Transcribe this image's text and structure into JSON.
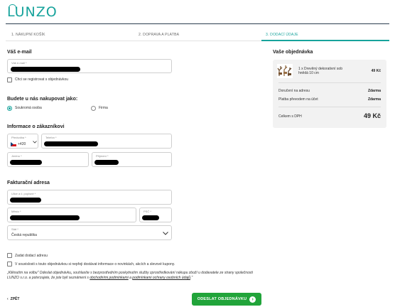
{
  "brand": {
    "logo": "LUNZO",
    "accent": "#17a39c",
    "button_color": "#21a43a"
  },
  "steps": [
    {
      "label": "1. NÁKUPNÍ KOŠÍK"
    },
    {
      "label": "2. DOPRAVA A PLATBA"
    },
    {
      "label": "3. DODACÍ ÚDAJE"
    }
  ],
  "email_section": {
    "title": "Váš e-mail",
    "email_label": "Váš e-mail *",
    "register_label": "Chci se registrovat s objednávkou"
  },
  "buyer_section": {
    "title": "Budete u nás nakupovat jako:",
    "option_private": "Soukromá osoba",
    "option_company": "Firma"
  },
  "customer_section": {
    "title": "Informace o zákazníkovi",
    "prefix_label": "Předvolba *",
    "prefix_value": "+420",
    "phone_label": "Telefon *",
    "first_name_label": "Jméno *",
    "last_name_label": "Příjmení *"
  },
  "billing_section": {
    "title": "Fakturační adresa",
    "street_label": "Ulice a č. popisné *",
    "city_label": "Město *",
    "zip_label": "PSČ *",
    "country_label": "Stát *",
    "country_value": "Česká republika"
  },
  "options": {
    "delivery_address": "Zadat dodací adresu",
    "newsletter": "V souvislosti s touto objednávkou si nepřeji dostávat informace o novinkách, akcích a slevové kupony."
  },
  "legal": {
    "text_1": "„Kliknutím na volbu\" Odeslat objednávku„ souhlasíte s bezprostředním poskytnutím služby zprostředkování nákupu zboží u dodavatele ze strany společnosti LUNZO s.r.o. a potvrzujete, že jste byli seznámeni s ",
    "link_1": "obchodními podmínkami",
    "text_2": " a ",
    "link_2": "podmínkami ochrany osobních údajů",
    "text_3": ".\""
  },
  "order": {
    "title": "Vaše objednávka",
    "item": "1 x Drevěný dekorativní sob hnědá 10 cm",
    "item_price": "49 Kč",
    "delivery_label": "Doručení na adresu",
    "delivery_value": "Zdarma",
    "payment_label": "Platba převodem na účet",
    "payment_value": "Zdarma",
    "total_label": "Celkem s DPH",
    "total_value": "49 Kč"
  },
  "footer": {
    "back_label": "ZPĚT",
    "submit_label": "ODESLAT OBJEDNÁVKU"
  }
}
